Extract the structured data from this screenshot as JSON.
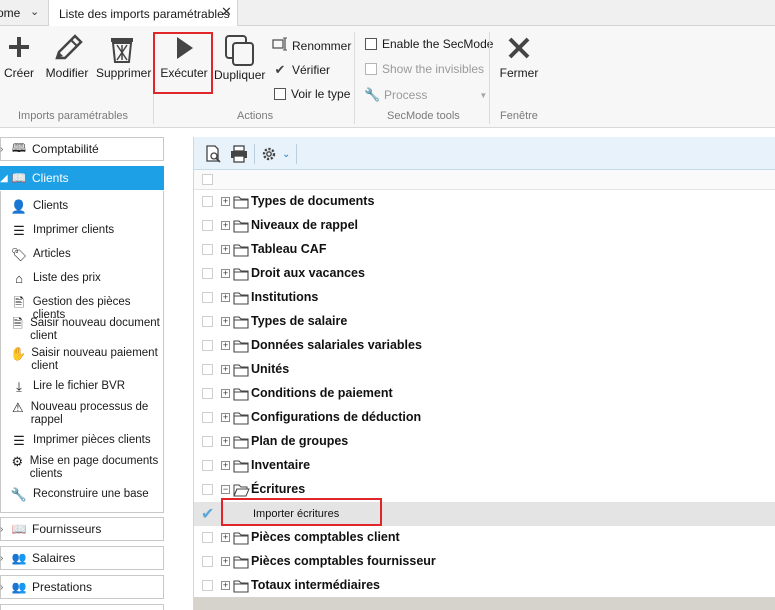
{
  "tabs": {
    "home_label": "ome",
    "active_label": "Liste des imports paramétrables"
  },
  "ribbon": {
    "groups": {
      "imports": "Imports paramétrables",
      "actions": "Actions",
      "secmode": "SecMode tools",
      "window": "Fenêtre"
    },
    "buttons": {
      "create": "Créer",
      "modify": "Modifier",
      "delete": "Supprimer",
      "execute": "Exécuter",
      "duplicate": "Dupliquer",
      "close": "Fermer"
    },
    "actions_small": {
      "rename": "Renommer",
      "verify": "Vérifier",
      "show_type": "Voir le type"
    },
    "secmode": {
      "enable": "Enable the SecMode",
      "show_invisibles": "Show the invisibles",
      "process": "Process"
    }
  },
  "nav": {
    "sections": {
      "comptabilite": "Comptabilité",
      "clients": "Clients",
      "fournisseurs": "Fournisseurs",
      "salaires": "Salaires",
      "prestations": "Prestations"
    },
    "client_items": [
      {
        "label": "Clients",
        "icon": "person-icon"
      },
      {
        "label": "Imprimer clients",
        "icon": "list-icon"
      },
      {
        "label": "Articles",
        "icon": "tag-icon"
      },
      {
        "label": "Liste des prix",
        "icon": "house-icon"
      },
      {
        "label": "Gestion des pièces clients",
        "icon": "document-icon"
      },
      {
        "label": "Saisir nouveau document client",
        "icon": "new-document-icon"
      },
      {
        "label": "Saisir nouveau paiement client",
        "icon": "payment-icon"
      },
      {
        "label": "Lire le fichier BVR",
        "icon": "download-icon"
      },
      {
        "label": "Nouveau processus de rappel",
        "icon": "warning-icon"
      },
      {
        "label": "Imprimer pièces clients",
        "icon": "list-icon"
      },
      {
        "label": "Mise en page documents clients",
        "icon": "gears-icon"
      },
      {
        "label": "Reconstruire une base",
        "icon": "wrench-icon"
      }
    ]
  },
  "tree": {
    "rows": [
      {
        "label": "Types de documents",
        "expanded": false
      },
      {
        "label": "Niveaux de rappel",
        "expanded": false
      },
      {
        "label": "Tableau CAF",
        "expanded": false
      },
      {
        "label": "Droit aux vacances",
        "expanded": false
      },
      {
        "label": "Institutions",
        "expanded": false
      },
      {
        "label": "Types de salaire",
        "expanded": false
      },
      {
        "label": "Données salariales variables",
        "expanded": false
      },
      {
        "label": "Unités",
        "expanded": false
      },
      {
        "label": "Conditions de paiement",
        "expanded": false
      },
      {
        "label": "Configurations de déduction",
        "expanded": false
      },
      {
        "label": "Plan de groupes",
        "expanded": false
      },
      {
        "label": "Inventaire",
        "expanded": false
      },
      {
        "label": "Écritures",
        "expanded": true
      },
      {
        "label": "Importer écritures",
        "leaf": true,
        "selected": true
      },
      {
        "label": "Pièces comptables client",
        "expanded": false
      },
      {
        "label": "Pièces comptables fournisseur",
        "expanded": false
      },
      {
        "label": "Totaux intermédiaires",
        "expanded": false
      }
    ]
  },
  "colors": {
    "accent": "#1ea0e6",
    "highlight": "#e0262a",
    "folder": "#f5d36b"
  }
}
